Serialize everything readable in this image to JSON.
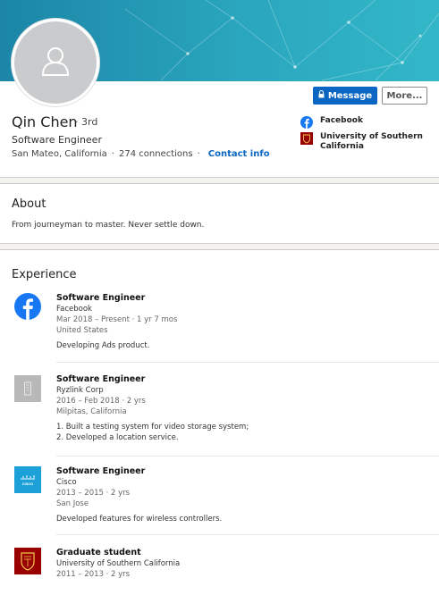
{
  "profile": {
    "name": "Qin Chen",
    "degree": "· 3rd",
    "headline": "Software Engineer",
    "location": "San Mateo, California",
    "connections": "274 connections",
    "contact_info": "Contact info",
    "message_label": "Message",
    "more_label": "More..."
  },
  "sidebar": {
    "items": [
      {
        "label": "Facebook",
        "icon": "facebook-icon"
      },
      {
        "label": "University of Southern California",
        "icon": "usc-logo"
      }
    ]
  },
  "about": {
    "title": "About",
    "text": "From journeyman to master. Never settle down."
  },
  "experience": {
    "title": "Experience",
    "items": [
      {
        "title": "Software Engineer",
        "company": "Facebook",
        "dates": "Mar 2018 – Present · 1 yr 7 mos",
        "location": "United States",
        "description": [
          "Developing Ads product."
        ],
        "logo": "facebook-logo"
      },
      {
        "title": "Software Engineer",
        "company": "Ryzlink Corp",
        "dates": "2016 – Feb 2018 · 2 yrs",
        "location": "Milpitas, California",
        "description": [
          "1. Built a testing system for video storage system;",
          "2. Developed a location service."
        ],
        "logo": "company-placeholder-logo"
      },
      {
        "title": "Software Engineer",
        "company": "Cisco",
        "dates": "2013 – 2015 · 2 yrs",
        "location": "San Jose",
        "description": [
          "Developed features for wireless controllers."
        ],
        "logo": "cisco-logo"
      },
      {
        "title": "Graduate student",
        "company": "University of Southern California",
        "dates": "2011 – 2013 · 2 yrs",
        "location": "",
        "description": [],
        "logo": "usc-logo"
      }
    ]
  },
  "colors": {
    "accent": "#0a66c2",
    "facebook": "#1877f2",
    "cisco": "#1ba0d7",
    "usc": "#990000",
    "banner": "#2aa6be"
  }
}
